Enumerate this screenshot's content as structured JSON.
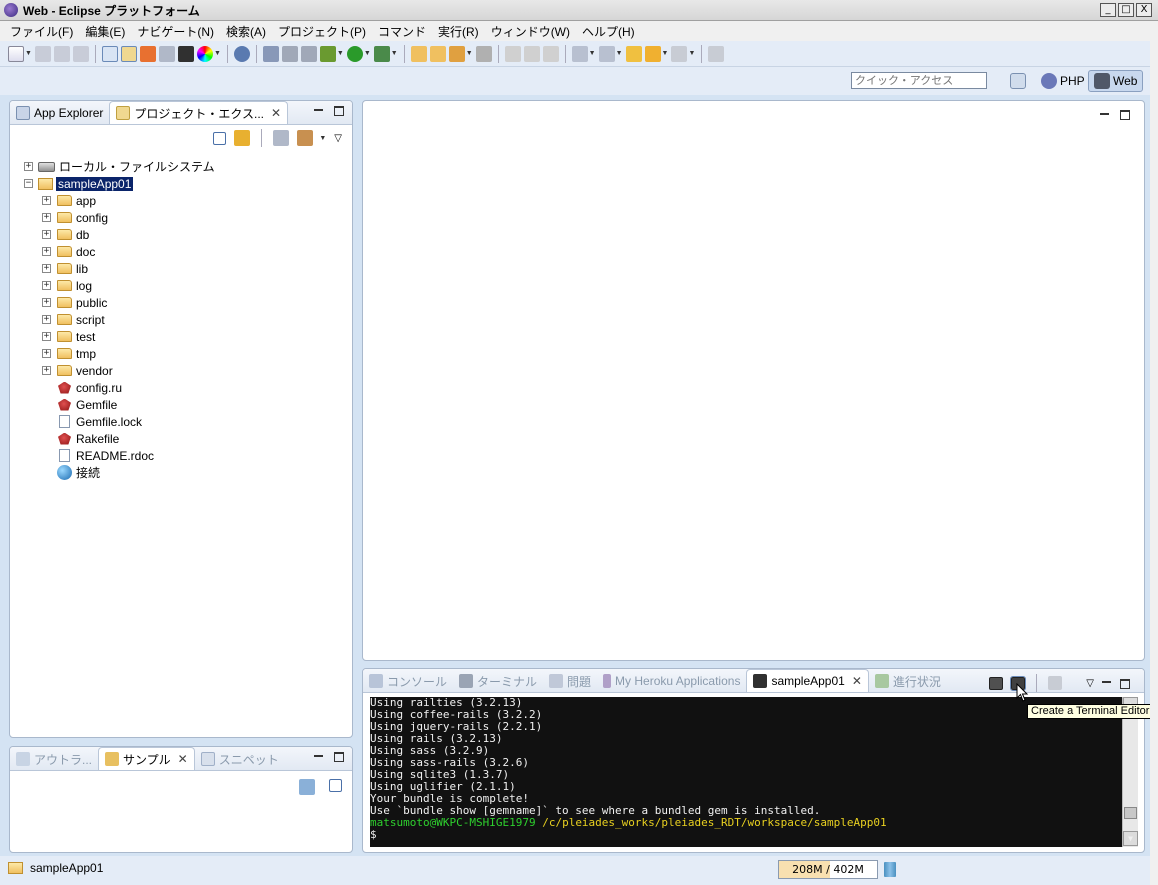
{
  "window": {
    "title": "Web - Eclipse プラットフォーム",
    "min": "_",
    "max": "□",
    "close": "X"
  },
  "menu": [
    "ファイル(F)",
    "編集(E)",
    "ナビゲート(N)",
    "検索(A)",
    "プロジェクト(P)",
    "コマンド",
    "実行(R)",
    "ウィンドウ(W)",
    "ヘルプ(H)"
  ],
  "toolbar": {
    "quick_access_placeholder": "クイック・アクセス",
    "perspectives": {
      "php": "PHP",
      "web": "Web"
    }
  },
  "explorer": {
    "tabs": {
      "app_explorer": "App Explorer",
      "project_explorer": "プロジェクト・エクス..."
    },
    "tree": {
      "local_fs": "ローカル・ファイルシステム",
      "project": "sampleApp01",
      "folders": [
        "app",
        "config",
        "db",
        "doc",
        "lib",
        "log",
        "public",
        "script",
        "test",
        "tmp",
        "vendor"
      ],
      "files": [
        {
          "name": "config.ru",
          "icon": "ruby"
        },
        {
          "name": "Gemfile",
          "icon": "ruby"
        },
        {
          "name": "Gemfile.lock",
          "icon": "file"
        },
        {
          "name": "Rakefile",
          "icon": "ruby"
        },
        {
          "name": "README.rdoc",
          "icon": "file"
        },
        {
          "name": "接続",
          "icon": "globe"
        }
      ]
    }
  },
  "outline": {
    "tabs": {
      "outline": "アウトラ...",
      "samples": "サンプル",
      "snippets": "スニペット"
    }
  },
  "console": {
    "tabs": {
      "console": "コンソール",
      "terminal": "ターミナル",
      "problems": "問題",
      "heroku": "My Heroku Applications",
      "session": "sampleApp01",
      "progress": "進行状況"
    },
    "lines": [
      "Using railties (3.2.13)",
      "Using coffee-rails (3.2.2)",
      "Using jquery-rails (2.2.1)",
      "Using rails (3.2.13)",
      "Using sass (3.2.9)",
      "Using sass-rails (3.2.6)",
      "Using sqlite3 (1.3.7)",
      "Using uglifier (2.1.1)",
      "Your bundle is complete!",
      "Use `bundle show [gemname]` to see where a bundled gem is installed."
    ],
    "prompt_user": "matsumoto@WKPC-MSHIGE1979",
    "prompt_path": " /c/pleiades_works/pleiades_RDT/workspace/sampleApp01",
    "prompt_symbol": "$"
  },
  "tooltip": "Create a Terminal Editor",
  "status": {
    "project": "sampleApp01",
    "heap": "208M / 402M",
    "heap_used_fraction": 0.52
  },
  "colors": {
    "selection": "#0a246a",
    "terminal_bg": "#111111",
    "prompt_user": "#2ed02e",
    "prompt_path": "#e8d020"
  }
}
